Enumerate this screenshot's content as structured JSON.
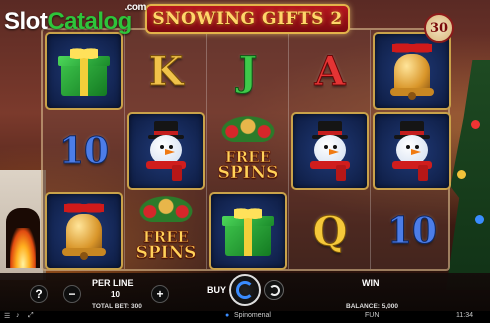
{
  "logo": {
    "slot": "Slot",
    "catalog": "Catalog",
    "com": ".com"
  },
  "title": "SNOWING GIFTS 2",
  "lines_count": "30",
  "reels": [
    [
      "gift",
      "10",
      "bell"
    ],
    [
      "K",
      "snowman",
      "free_spins"
    ],
    [
      "J",
      "free_spins",
      "gift"
    ],
    [
      "A",
      "snowman",
      "Q"
    ],
    [
      "bell",
      "snowman",
      "10"
    ]
  ],
  "free_spins_symbol": {
    "line1": "FREE",
    "line2": "SPINS"
  },
  "controls": {
    "help_label": "?",
    "minus_label": "−",
    "plus_label": "+",
    "per_line_label": "PER LINE",
    "per_line_value": "10",
    "total_bet_label": "TOTAL BET: 300",
    "buy_label": "BUY",
    "win_label": "WIN",
    "balance_label": "BALANCE: 5,000"
  },
  "status_bar": {
    "brand": "Spinomenal",
    "mode": "FUN",
    "time": "11:34"
  },
  "colors": {
    "title_bg": "#b8171f",
    "title_text": "#ffd66a",
    "spin_ring": "#3a8cff",
    "logo_green": "#2ec43a"
  }
}
